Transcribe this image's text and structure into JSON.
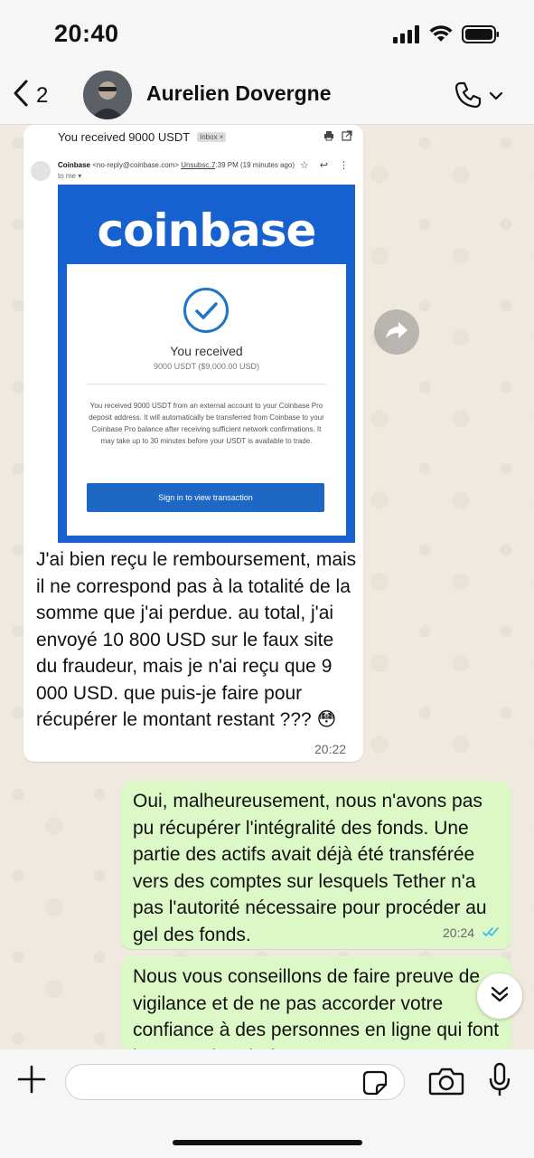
{
  "status_bar": {
    "time": "20:40"
  },
  "header": {
    "back_count": "2",
    "contact_name": "Aurelien Dovergne"
  },
  "email_screenshot": {
    "subject": "You received 9000 USDT",
    "inbox_tag": "Inbox ×",
    "sender_name": "Coinbase",
    "sender_address": "<no-reply@coinbase.com>",
    "unsubscribe": "Unsubsc...",
    "time": "7:39 PM (19 minutes ago)",
    "to": "to me ▾",
    "logo": "coinbase",
    "received_title": "You received",
    "received_amount": "9000 USDT ($9,000.00 USD)",
    "body": "You received 9000 USDT from an external account to your Coinbase Pro deposit address. It will automatically be transferred from Coinbase to your Coinbase Pro balance after receiving sufficient network confirmations. It may take up to 30 minutes before your USDT is available to trade.",
    "button": "Sign in to view transaction"
  },
  "messages": {
    "incoming": {
      "text": "J'ai bien reçu le remboursement, mais il ne correspond pas à la totalité de la somme que j'ai perdue. au total, j'ai envoyé 10 800 USD sur le faux site du fraudeur, mais je n'ai reçu que 9 000 USD. que puis-je faire pour récupérer le montant restant ??? 😳",
      "time": "20:22"
    },
    "outgoing_1": {
      "text": "Oui, malheureusement, nous n'avons pas pu récupérer l'intégralité des fonds. Une partie des actifs avait déjà été transférée vers des comptes sur lesquels Tether n'a pas l'autorité nécessaire pour procéder au gel des fonds.",
      "time": "20:24",
      "read_ticks": "✓✓"
    },
    "outgoing_2": {
      "text": "Nous vous conseillons de faire preuve de vigilance et de ne pas accorder votre confiance à des personnes en ligne qui font la promotion de faux"
    }
  },
  "input": {
    "placeholder": ""
  },
  "colors": {
    "outgoing_bubble": "#dcf8c6",
    "incoming_bubble": "#ffffff",
    "coinbase_blue": "#1660cf",
    "read_tick": "#34b7f1",
    "chat_background": "#efe9df"
  },
  "icons": [
    "signal-icon",
    "wifi-icon",
    "battery-icon",
    "back-chevron-icon",
    "phone-icon",
    "chevron-down-icon",
    "forward-icon",
    "double-chevron-down-icon",
    "plus-icon",
    "sticker-icon",
    "camera-icon",
    "mic-icon",
    "check-icon"
  ]
}
